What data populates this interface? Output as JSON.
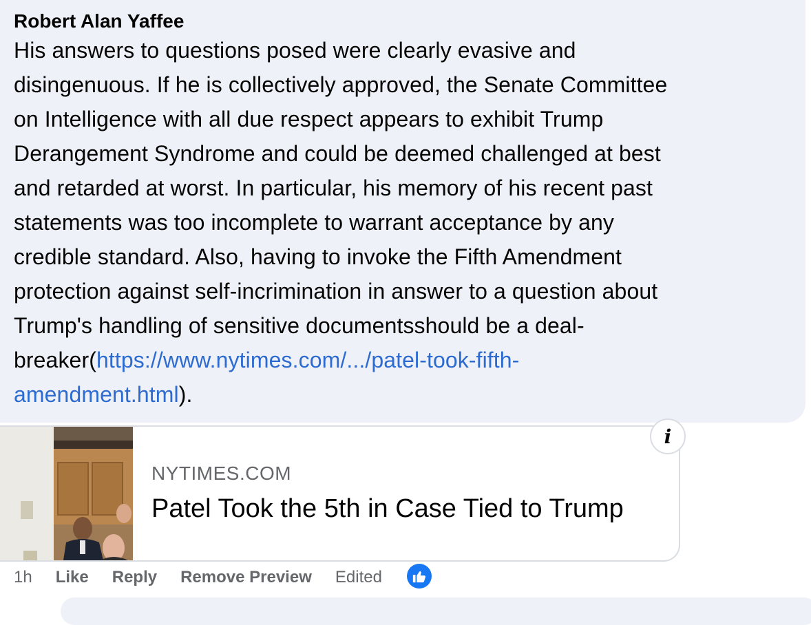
{
  "comment": {
    "author": "Robert Alan Yaffee",
    "text_before_link": "His answers to questions posed were clearly evasive and\ndisingenuous. If he is collectively approved, the Senate Committee\non Intelligence with all due respect appears to exhibit Trump\nDerangement Syndrome and could be deemed challenged at best\nand retarded at worst. In particular, his memory of his recent past\nstatements was too incomplete to warrant acceptance by any\ncredible standard. Also, having to invoke the Fifth Amendment\nprotection against self-incrimination in answer to a question about\nTrump's handling of sensitive documentsshould be a deal-\nbreaker(",
    "link_text": "https://www.nytimes.com/.../patel-took-fifth-\namendment.html",
    "text_after_link": ")."
  },
  "link_preview": {
    "domain": "NYTIMES.COM",
    "title": "Patel Took the 5th in Case Tied to Trump",
    "thumbnail_icon": "news-photo",
    "info_icon": "info-icon"
  },
  "actions": {
    "time": "1h",
    "like": "Like",
    "reply": "Reply",
    "remove_preview": "Remove Preview",
    "edited": "Edited",
    "reaction_icon": "thumbs-up-icon"
  },
  "colors": {
    "bubble": "#eef1f7",
    "link": "#2d6bd0",
    "meta": "#65676b",
    "reaction": "#1877f2"
  }
}
